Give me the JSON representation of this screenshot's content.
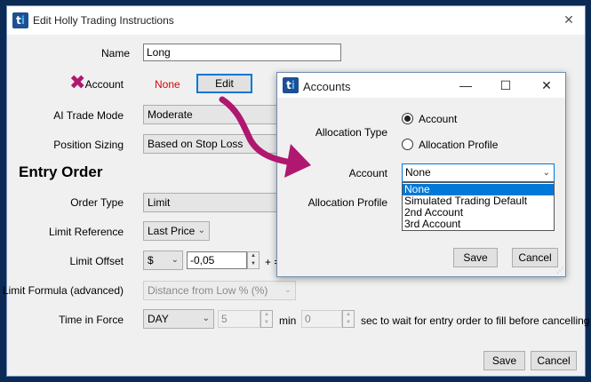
{
  "main_window": {
    "title": "Edit Holly Trading Instructions",
    "icon_text": "ti",
    "fields": {
      "name_label": "Name",
      "name_value": "Long",
      "account_label": "Account",
      "account_value": "None",
      "edit_button": "Edit",
      "ai_trade_mode_label": "AI Trade Mode",
      "ai_trade_mode_value": "Moderate",
      "position_sizing_label": "Position Sizing",
      "position_sizing_value": "Based on Stop Loss"
    },
    "entry_order": {
      "section_title": "Entry Order",
      "order_type_label": "Order Type",
      "order_type_value": "Limit",
      "limit_reference_label": "Limit Reference",
      "limit_reference_value": "Last Price",
      "limit_offset_label": "Limit Offset",
      "limit_offset_unit": "$",
      "limit_offset_value": "-0,05",
      "limit_offset_suffix": "+ =",
      "limit_formula_label": "Limit Formula (advanced)",
      "limit_formula_value": "Distance from Low % (%)",
      "time_in_force_label": "Time in Force",
      "time_in_force_value": "DAY",
      "time_min_value": "5",
      "min_label": "min",
      "time_sec_value": "0",
      "sec_label": "sec to wait for entry order to fill before cancelling"
    },
    "save_button": "Save",
    "cancel_button": "Cancel"
  },
  "accounts_dialog": {
    "title": "Accounts",
    "icon_text": "ti",
    "allocation_type_label": "Allocation Type",
    "radio_account": "Account",
    "radio_allocation_profile": "Allocation Profile",
    "selected_radio": "Account",
    "account_label": "Account",
    "account_value": "None",
    "account_options": [
      "None",
      "Simulated Trading Default",
      "2nd Account",
      "3rd Account"
    ],
    "allocation_profile_label": "Allocation Profile",
    "save_button": "Save",
    "cancel_button": "Cancel"
  },
  "icons": {
    "close": "close-icon",
    "minimize": "minimize-icon",
    "maximize": "maximize-icon",
    "chevron": "chevron-down-icon",
    "annotation_x": "x-mark-icon",
    "annotation_arrow": "curved-arrow-icon"
  },
  "colors": {
    "background": "#0b2a55",
    "accent": "#0078d7",
    "none_text": "#e00000",
    "annotation": "#b0176f",
    "icon_bg": "#1e4f92"
  }
}
